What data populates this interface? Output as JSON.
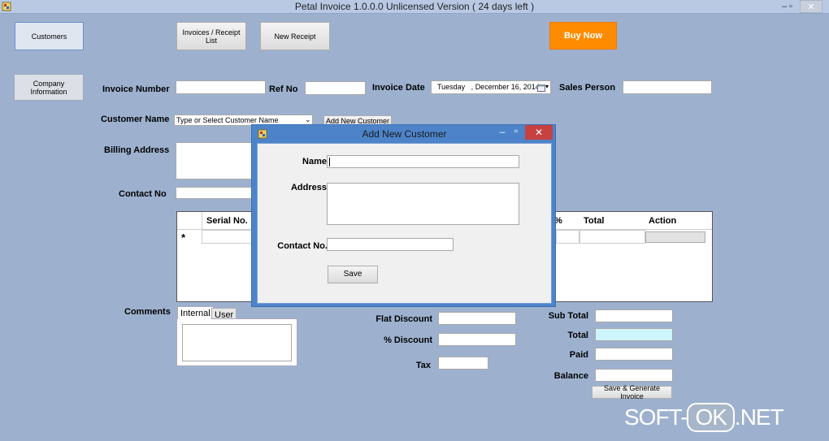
{
  "window": {
    "title": "Petal Invoice 1.0.0.0 Unlicensed Version ( 24 days left )",
    "min": "–",
    "restore": "▫",
    "close": "✕"
  },
  "nav": {
    "customers": "Customers",
    "company_info": "Company Information",
    "invoices_list": "Invoices / Receipt List",
    "new_receipt": "New Receipt",
    "buy_now": "Buy Now"
  },
  "form": {
    "invoice_number_label": "Invoice Number",
    "ref_no_label": "Ref No",
    "invoice_date_label": "Invoice Date",
    "invoice_date_value": "Tuesday   , December 16, 2014",
    "sales_person_label": "Sales Person",
    "customer_name_label": "Customer Name",
    "customer_name_placeholder": "Type or Select Customer Name",
    "add_new_customer": "Add New Customer",
    "billing_address_label": "Billing Address",
    "contact_no_label": "Contact No"
  },
  "grid": {
    "headers": [
      "Serial No.",
      "%",
      "Total",
      "Action"
    ],
    "new_row_marker": "*"
  },
  "comments": {
    "label": "Comments",
    "tabs": [
      "Internal",
      "User"
    ]
  },
  "totals": {
    "flat_discount": "Flat Discount",
    "pct_discount": "% Discount",
    "tax": "Tax",
    "sub_total": "Sub Total",
    "total": "Total",
    "paid": "Paid",
    "balance": "Balance",
    "save_generate": "Save & Generate Invoice"
  },
  "dialog": {
    "title": "Add New Customer",
    "min": "–",
    "restore": "▫",
    "close": "✕",
    "name_label": "Name",
    "address_label": "Address",
    "contact_label": "Contact No.",
    "save": "Save"
  },
  "watermark": {
    "left": "SOFT-",
    "mid": "OK",
    "right": ".NET"
  },
  "colors": {
    "background": "#9db1cf",
    "buy_now": "#ff8c00",
    "dialog_frame": "#4d84c9",
    "total_field": "#cdf5fb"
  }
}
